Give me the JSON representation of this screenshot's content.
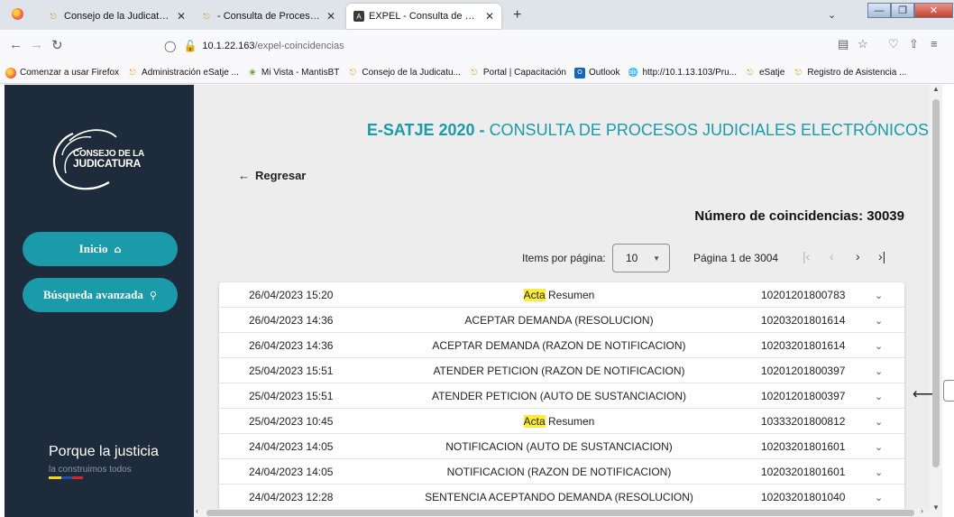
{
  "browser": {
    "tabs": [
      {
        "title": "Consejo de la Judicatura | Cons",
        "favicon": "cj-icon",
        "active": false
      },
      {
        "title": "- Consulta de Procesos - eSATJE",
        "favicon": "cj-icon",
        "active": false
      },
      {
        "title": "EXPEL - Consulta de procesos",
        "favicon": "angular-icon",
        "active": true
      }
    ],
    "url_host": "10.1.22.163",
    "url_path": "/expel-coincidencias",
    "bookmarks": [
      {
        "label": "Comenzar a usar Firefox",
        "icon": "firefox-icon"
      },
      {
        "label": "Administración eSatje ...",
        "icon": "cj-icon"
      },
      {
        "label": "Mi Vista - MantisBT",
        "icon": "mantis-icon"
      },
      {
        "label": "Consejo de la Judicatu...",
        "icon": "cj-icon"
      },
      {
        "label": "Portal | Capacitación",
        "icon": "cj-icon"
      },
      {
        "label": "Outlook",
        "icon": "outlook-icon"
      },
      {
        "label": "http://10.1.13.103/Pru...",
        "icon": "globe-icon"
      },
      {
        "label": "eSatje",
        "icon": "cj-icon"
      },
      {
        "label": "Registro de Asistencia ...",
        "icon": "cj-icon"
      }
    ]
  },
  "sidebar": {
    "logo_line1": "CONSEJO DE LA",
    "logo_line2": "JUDICATURA",
    "nav": [
      {
        "label": "Inicio",
        "icon": "home-icon"
      },
      {
        "label": "Búsqueda avanzada",
        "icon": "search-icon"
      }
    ],
    "slogan": "Porque la justicia",
    "slogan_sub": "la construimos todos",
    "flag_colors": [
      "#f7d417",
      "#1f4fa8",
      "#d6252b"
    ]
  },
  "main": {
    "title_bold": "E-SATJE 2020 -",
    "title_rest": "CONSULTA DE PROCESOS JUDICIALES ELECTRÓNICOS",
    "back_label": "Regresar",
    "matches_label": "Número de coincidencias: 30039",
    "items_per_page_label": "Items por página:",
    "items_per_page_value": "10",
    "page_info": "Página 1 de 3004",
    "accent_color": "#1b9aaa",
    "rows": [
      {
        "date": "26/04/2023 15:20",
        "highlight": "Acta",
        "desc": "Resumen",
        "number": "10201201800783"
      },
      {
        "date": "26/04/2023 14:36",
        "highlight": "",
        "desc": "ACEPTAR DEMANDA (RESOLUCION)",
        "number": "10203201801614"
      },
      {
        "date": "26/04/2023 14:36",
        "highlight": "",
        "desc": "ACEPTAR DEMANDA (RAZON DE NOTIFICACION)",
        "number": "10203201801614"
      },
      {
        "date": "25/04/2023 15:51",
        "highlight": "",
        "desc": "ATENDER PETICION (RAZON DE NOTIFICACION)",
        "number": "10201201800397"
      },
      {
        "date": "25/04/2023 15:51",
        "highlight": "",
        "desc": "ATENDER PETICION (AUTO DE SUSTANCIACION)",
        "number": "10201201800397"
      },
      {
        "date": "25/04/2023 10:45",
        "highlight": "Acta",
        "desc": "Resumen",
        "number": "10333201800812"
      },
      {
        "date": "24/04/2023 14:05",
        "highlight": "",
        "desc": "NOTIFICACION (AUTO DE SUSTANCIACION)",
        "number": "10203201801601"
      },
      {
        "date": "24/04/2023 14:05",
        "highlight": "",
        "desc": "NOTIFICACION (RAZON DE NOTIFICACION)",
        "number": "10203201801601"
      },
      {
        "date": "24/04/2023 12:28",
        "highlight": "",
        "desc": "SENTENCIA ACEPTANDO DEMANDA (RESOLUCION)",
        "number": "10203201801040"
      }
    ]
  }
}
